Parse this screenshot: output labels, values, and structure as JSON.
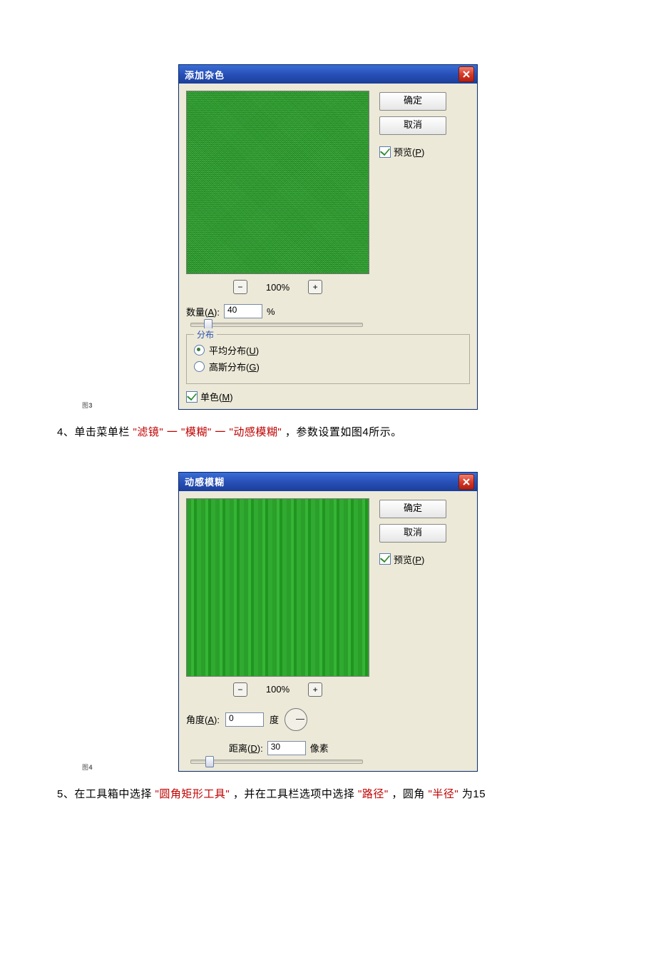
{
  "fig3": {
    "label_prefix": "图",
    "label_num": "3"
  },
  "fig4": {
    "label_prefix": "图",
    "label_num": "4"
  },
  "dialog_noise": {
    "title": "添加杂色",
    "ok": "确定",
    "cancel": "取消",
    "preview_label": "预览(P)",
    "zoom_value": "100%",
    "amount_label": "数量(A):",
    "amount_value": "40",
    "amount_unit": "%",
    "dist_legend": "分布",
    "dist_uniform": "平均分布(U)",
    "dist_gaussian": "高斯分布(G)",
    "mono_label": "单色(M)"
  },
  "dialog_motion": {
    "title": "动感模糊",
    "ok": "确定",
    "cancel": "取消",
    "preview_label": "预览(P)",
    "zoom_value": "100%",
    "angle_label": "角度(A):",
    "angle_value": "0",
    "angle_unit": "度",
    "distance_label": "距离(D):",
    "distance_value": "30",
    "distance_unit": "像素"
  },
  "para4": {
    "prefix": "4、单击菜单栏",
    "q1": "\"滤镜\"",
    "sep": "一",
    "q2": "\"模糊\"",
    "q3": "\"动感模糊\"",
    "suffix": "，参数设置如图4所示。"
  },
  "para5": {
    "prefix": "5、在工具箱中选择",
    "q1": "\"圆角矩形工具\"",
    "mid1": "，并在工具栏选项中选择",
    "q2": "\"路径\"",
    "mid2": "，圆角",
    "q3": "\"半径\"",
    "suffix": "为15"
  }
}
